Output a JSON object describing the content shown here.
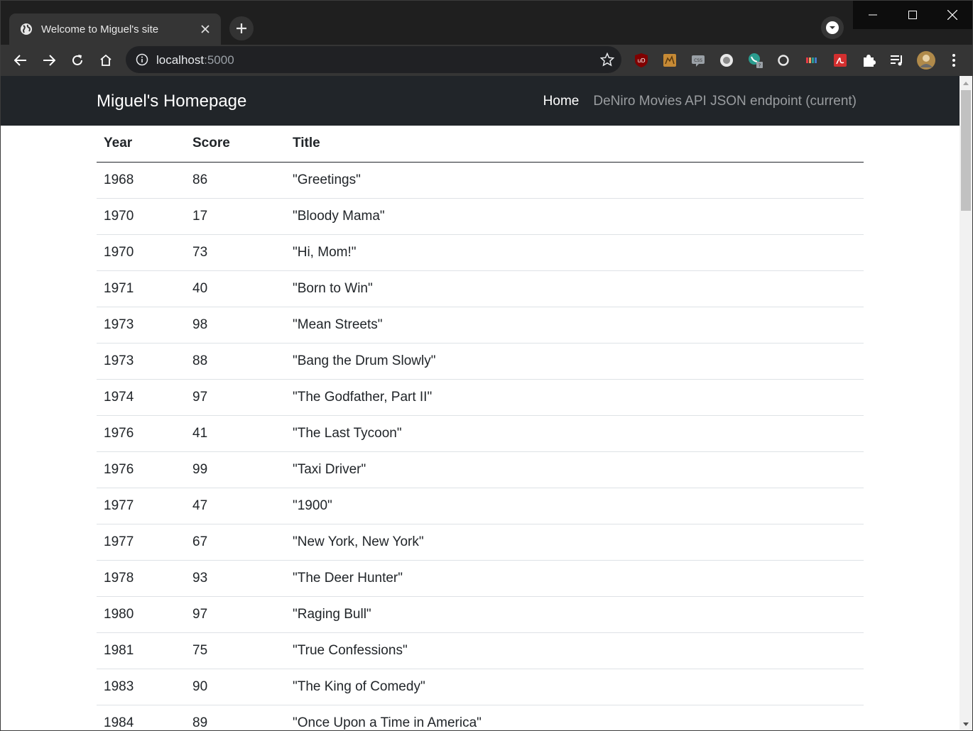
{
  "browser": {
    "tab_title": "Welcome to Miguel's site",
    "url_host": "localhost",
    "url_port": ":5000",
    "colors": {
      "tabstrip": "#1f1f1f",
      "toolbar": "#353535",
      "omnibox": "#202124"
    }
  },
  "site": {
    "brand": "Miguel's Homepage",
    "nav": [
      {
        "label": "Home"
      },
      {
        "label": "DeNiro Movies API JSON endpoint (current)"
      }
    ],
    "colors": {
      "navbar": "#212529"
    }
  },
  "table": {
    "headers": [
      "Year",
      "Score",
      "Title"
    ],
    "rows": [
      {
        "year": "1968",
        "score": "86",
        "title": "\"Greetings\""
      },
      {
        "year": "1970",
        "score": "17",
        "title": "\"Bloody Mama\""
      },
      {
        "year": "1970",
        "score": "73",
        "title": "\"Hi, Mom!\""
      },
      {
        "year": "1971",
        "score": "40",
        "title": "\"Born to Win\""
      },
      {
        "year": "1973",
        "score": "98",
        "title": "\"Mean Streets\""
      },
      {
        "year": "1973",
        "score": "88",
        "title": "\"Bang the Drum Slowly\""
      },
      {
        "year": "1974",
        "score": "97",
        "title": "\"The Godfather, Part II\""
      },
      {
        "year": "1976",
        "score": "41",
        "title": "\"The Last Tycoon\""
      },
      {
        "year": "1976",
        "score": "99",
        "title": "\"Taxi Driver\""
      },
      {
        "year": "1977",
        "score": "47",
        "title": "\"1900\""
      },
      {
        "year": "1977",
        "score": "67",
        "title": "\"New York, New York\""
      },
      {
        "year": "1978",
        "score": "93",
        "title": "\"The Deer Hunter\""
      },
      {
        "year": "1980",
        "score": "97",
        "title": "\"Raging Bull\""
      },
      {
        "year": "1981",
        "score": "75",
        "title": "\"True Confessions\""
      },
      {
        "year": "1983",
        "score": "90",
        "title": "\"The King of Comedy\""
      },
      {
        "year": "1984",
        "score": "89",
        "title": "\"Once Upon a Time in America\""
      }
    ]
  },
  "icons": {
    "extensions": [
      "ublock-icon",
      "camel-icon",
      "css-icon",
      "record-icon",
      "phone-icon",
      "circle-icon",
      "rainbow-icon",
      "pdf-icon",
      "puzzle-icon",
      "media-icon",
      "avatar",
      "menu-dots-icon"
    ]
  }
}
